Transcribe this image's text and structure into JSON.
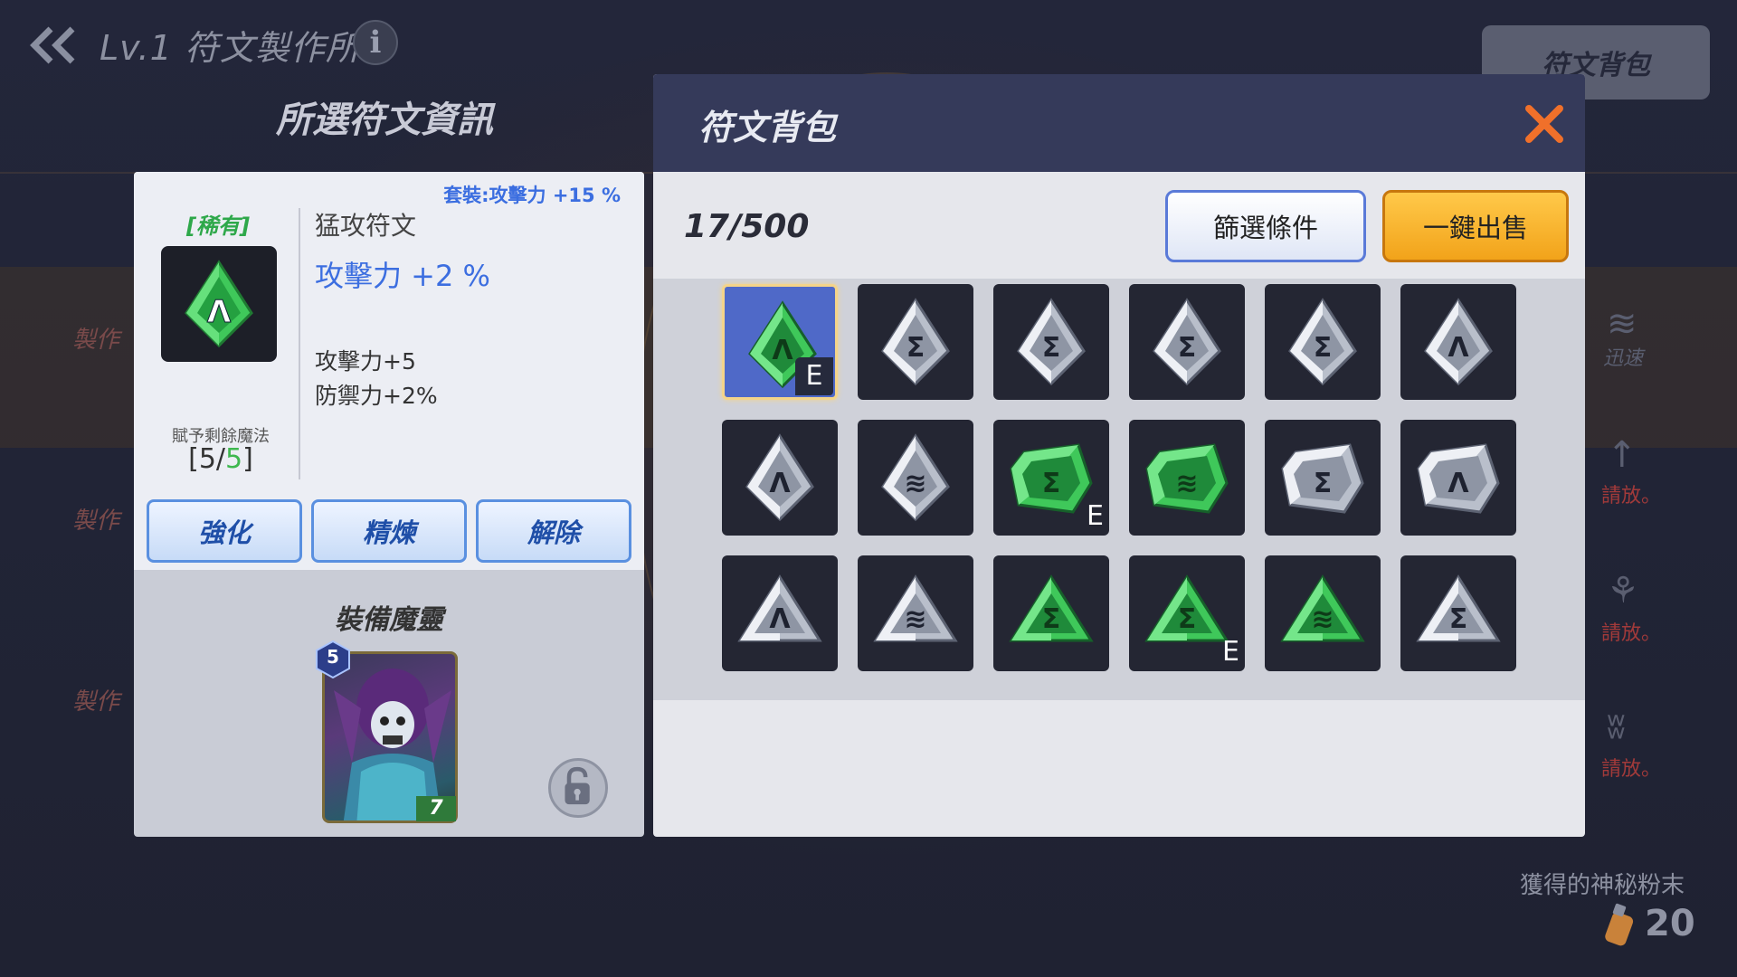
{
  "header": {
    "title": "Lv.1 符文製作所",
    "info_label": "i",
    "top_tab": "符文背包"
  },
  "left_panel": {
    "title": "所選符文資訊",
    "set_bonus": "套裝:攻擊力 +15 %",
    "rarity": "[稀有]",
    "rune_name": "猛攻符文",
    "main_stat": "攻擊力 +2 %",
    "sub_stats": [
      "攻擊力+5",
      "防禦力+2%"
    ],
    "remaining_label": "賦予剩餘魔法",
    "remaining_open": "[5/",
    "remaining_value": "5",
    "remaining_close": "]",
    "buttons": [
      "強化",
      "精煉",
      "解除"
    ],
    "equip_title": "裝備魔靈",
    "hero_level": "5",
    "hero_cost": "7"
  },
  "modal": {
    "title": "符文背包",
    "capacity": "17/500",
    "filter_label": "篩選條件",
    "sell_label": "一鍵出售",
    "equipped_tag": "E",
    "slots": [
      {
        "color": "green",
        "glyph": "A",
        "equipped": true,
        "selected": true,
        "shape": "diamond"
      },
      {
        "color": "silver",
        "glyph": "S",
        "equipped": false,
        "shape": "diamond"
      },
      {
        "color": "silver",
        "glyph": "S",
        "equipped": false,
        "shape": "diamond"
      },
      {
        "color": "silver",
        "glyph": "S",
        "equipped": false,
        "shape": "diamond"
      },
      {
        "color": "silver",
        "glyph": "S",
        "equipped": false,
        "shape": "diamond"
      },
      {
        "color": "silver",
        "glyph": "A",
        "equipped": false,
        "shape": "diamond"
      },
      {
        "color": "silver",
        "glyph": "A",
        "equipped": false,
        "shape": "diamond"
      },
      {
        "color": "silver",
        "glyph": "W",
        "equipped": false,
        "shape": "diamond"
      },
      {
        "color": "green",
        "glyph": "S",
        "equipped": true,
        "shape": "hex"
      },
      {
        "color": "green",
        "glyph": "W",
        "equipped": false,
        "shape": "hex"
      },
      {
        "color": "silver",
        "glyph": "S",
        "equipped": false,
        "shape": "hex"
      },
      {
        "color": "silver",
        "glyph": "A",
        "equipped": false,
        "shape": "hex"
      },
      {
        "color": "silver",
        "glyph": "A",
        "equipped": false,
        "shape": "tri"
      },
      {
        "color": "silver",
        "glyph": "W",
        "equipped": false,
        "shape": "tri"
      },
      {
        "color": "green",
        "glyph": "S",
        "equipped": false,
        "shape": "tri"
      },
      {
        "color": "green",
        "glyph": "S",
        "equipped": true,
        "shape": "tri"
      },
      {
        "color": "green",
        "glyph": "W",
        "equipped": false,
        "shape": "tri"
      },
      {
        "color": "silver",
        "glyph": "S",
        "equipped": false,
        "shape": "tri"
      }
    ]
  },
  "background": {
    "ghost_texts": [
      "製作",
      "製作",
      "製作"
    ],
    "side_texts": [
      "請放。",
      "請放。",
      "請放。"
    ],
    "side_label": "迅速"
  },
  "dust": {
    "label": "獲得的神秘粉末",
    "value": "20"
  },
  "colors": {
    "green_rune": "#3fc85a",
    "silver_rune": "#c7ccd6",
    "accent_blue": "#3c6ee0",
    "close_orange": "#f0702a"
  }
}
